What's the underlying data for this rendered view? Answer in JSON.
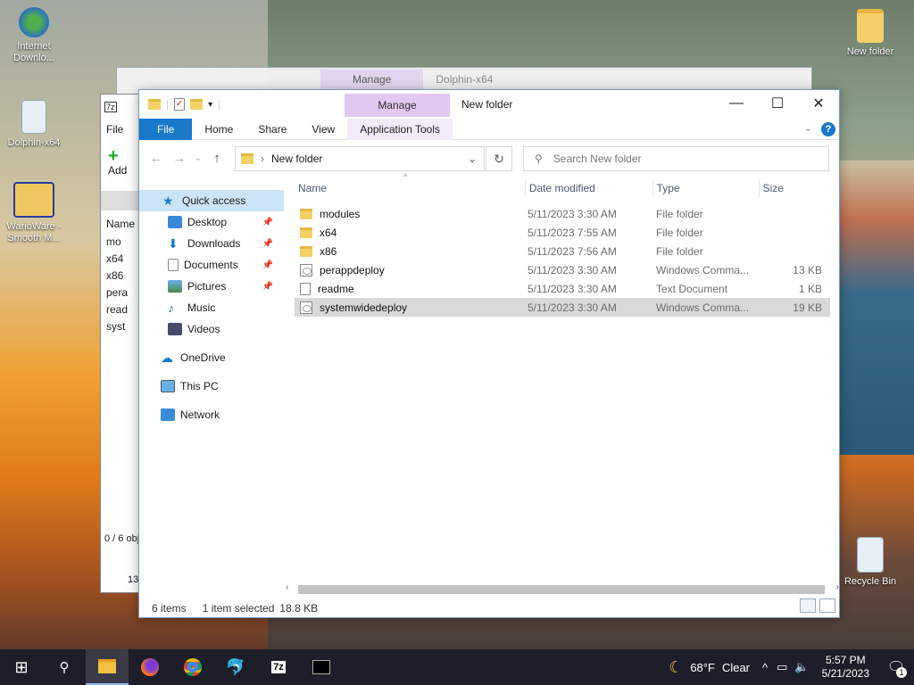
{
  "desktop": {
    "icons": [
      {
        "label": "Internet Downlo..."
      },
      {
        "label": "Dolphin-x64"
      },
      {
        "label": "WarioWare - Smooth M..."
      },
      {
        "label": "New folder"
      },
      {
        "label": "Recycle Bin"
      }
    ]
  },
  "bg_window": {
    "manage": "Manage",
    "title": "Dolphin-x64"
  },
  "sevenzip": {
    "menu_file": "File",
    "add_label": "Add",
    "col_name": "Name",
    "rows": [
      "mo",
      "x64",
      "x86",
      "pera",
      "read",
      "syst"
    ],
    "status": "0 / 6 obj",
    "count": "13"
  },
  "window": {
    "manage_tab": "Manage",
    "title": "New folder",
    "ribbon": {
      "file": "File",
      "home": "Home",
      "share": "Share",
      "view": "View",
      "app_tools": "Application Tools"
    },
    "address": "New folder",
    "search_placeholder": "Search New folder",
    "columns": {
      "name": "Name",
      "date": "Date modified",
      "type": "Type",
      "size": "Size"
    },
    "nav": {
      "quick_access": "Quick access",
      "desktop": "Desktop",
      "downloads": "Downloads",
      "documents": "Documents",
      "pictures": "Pictures",
      "music": "Music",
      "videos": "Videos",
      "onedrive": "OneDrive",
      "this_pc": "This PC",
      "network": "Network"
    },
    "files": [
      {
        "name": "modules",
        "date": "5/11/2023 3:30 AM",
        "type": "File folder",
        "size": "",
        "icon": "folder"
      },
      {
        "name": "x64",
        "date": "5/11/2023 7:55 AM",
        "type": "File folder",
        "size": "",
        "icon": "folder"
      },
      {
        "name": "x86",
        "date": "5/11/2023 7:56 AM",
        "type": "File folder",
        "size": "",
        "icon": "folder"
      },
      {
        "name": "perappdeploy",
        "date": "5/11/2023 3:30 AM",
        "type": "Windows Comma...",
        "size": "13 KB",
        "icon": "cmd"
      },
      {
        "name": "readme",
        "date": "5/11/2023 3:30 AM",
        "type": "Text Document",
        "size": "1 KB",
        "icon": "txt"
      },
      {
        "name": "systemwidedeploy",
        "date": "5/11/2023 3:30 AM",
        "type": "Windows Comma...",
        "size": "19 KB",
        "icon": "cmd"
      }
    ],
    "status": {
      "items": "6 items",
      "selected": "1 item selected",
      "size": "18.8 KB"
    }
  },
  "taskbar": {
    "weather": "68°F",
    "weather_desc": "Clear",
    "time": "5:57 PM",
    "date": "5/21/2023",
    "notif_count": "1"
  },
  "colors": {
    "accent": "#1979ca",
    "manage": "#e0c8f0",
    "selected": "#d9d9d9"
  }
}
